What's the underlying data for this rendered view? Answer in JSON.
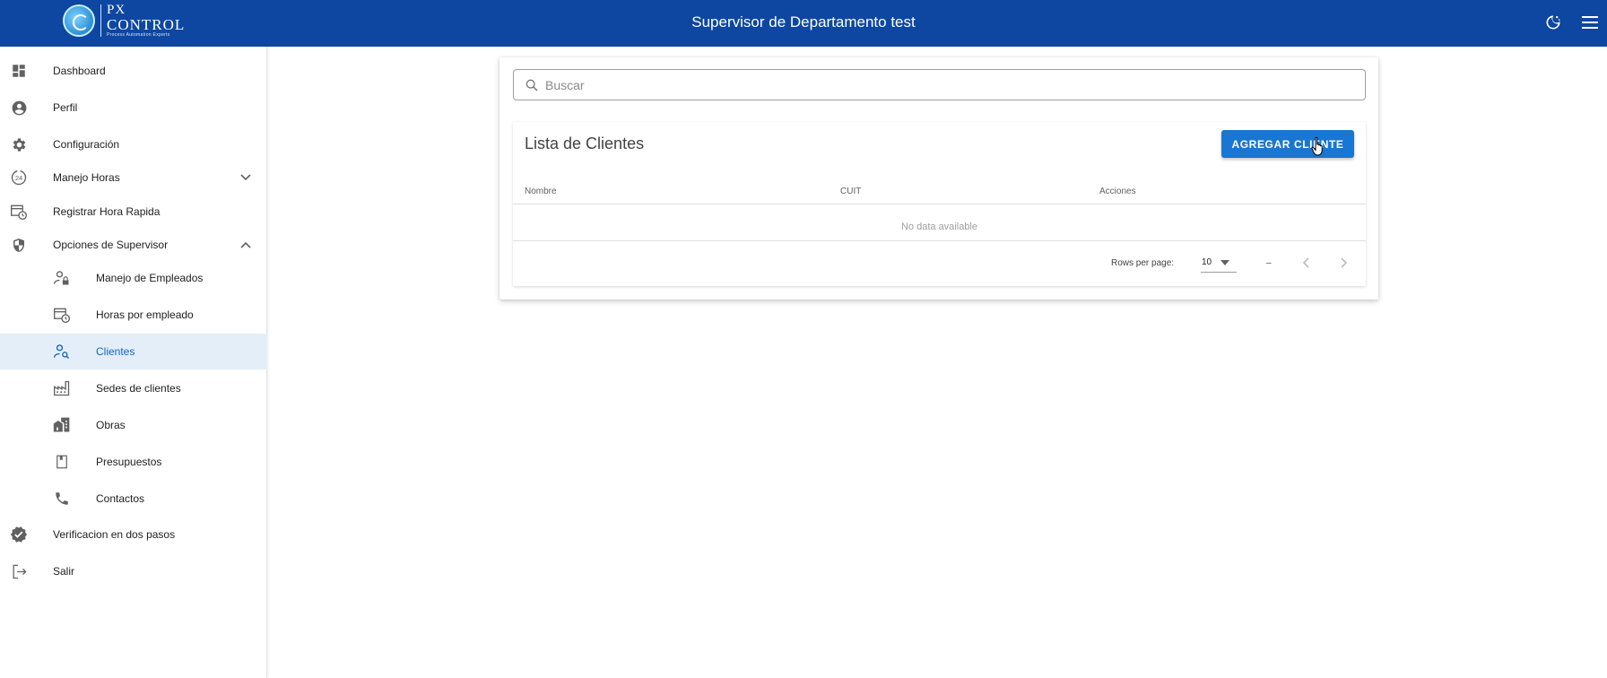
{
  "header": {
    "logo": {
      "line1": "PX",
      "line2": "CONTROL",
      "tagline": "Process Automation Experts"
    },
    "title": "Supervisor de  Departamento test",
    "theme_icon": "theme-toggle-icon",
    "menu_icon": "hamburger-menu-icon",
    "color": "#0d47a1"
  },
  "sidebar": {
    "items": [
      {
        "label": "Dashboard",
        "icon": "dashboard-icon"
      },
      {
        "label": "Perfil",
        "icon": "account-circle-icon"
      },
      {
        "label": "Configuración",
        "icon": "gear-icon"
      },
      {
        "label": "Manejo Horas",
        "icon": "24h-clock-icon"
      },
      {
        "label": "Registrar Hora Rapida",
        "icon": "calendar-clock-icon"
      },
      {
        "label": "Opciones de Supervisor",
        "icon": "shield-icon"
      },
      {
        "label": "Manejo de Empleados",
        "icon": "user-lock-icon"
      },
      {
        "label": "Horas por empleado",
        "icon": "calendar-clock-icon"
      },
      {
        "label": "Clientes",
        "icon": "user-search-icon"
      },
      {
        "label": "Sedes de clientes",
        "icon": "factory-icon"
      },
      {
        "label": "Obras",
        "icon": "buildings-icon"
      },
      {
        "label": "Presupuestos",
        "icon": "clipboard-icon"
      },
      {
        "label": "Contactos",
        "icon": "phone-icon"
      },
      {
        "label": "Verificacion en dos pasos",
        "icon": "verified-check-icon"
      },
      {
        "label": "Salir",
        "icon": "logout-icon"
      }
    ],
    "active_item": "Clientes",
    "active_color": "#1565c0"
  },
  "main": {
    "search_placeholder": "Buscar",
    "list_title": "Lista de Clientes",
    "add_button": "AGREGAR CLIENTE",
    "columns": [
      "Nombre",
      "CUIT",
      "Acciones"
    ],
    "empty_text": "No data available",
    "rows_per_page_label": "Rows per page:",
    "rows_per_page_value": "10",
    "page_range": "–",
    "accent": "#1976d2"
  }
}
